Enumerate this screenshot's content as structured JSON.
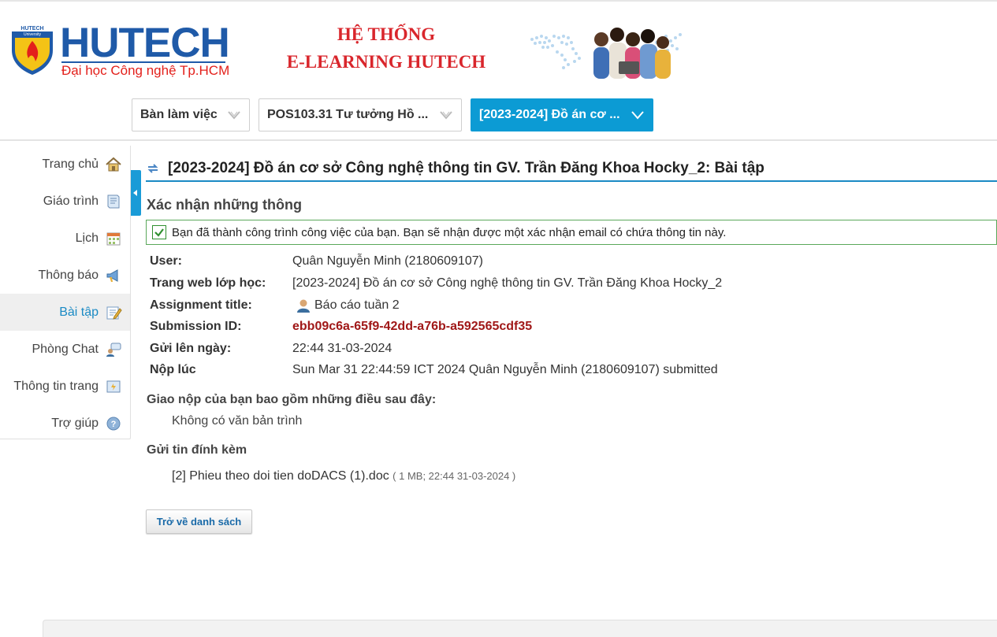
{
  "brand": {
    "logo_word": "HUTECH",
    "logo_small": "HUTECH University",
    "logo_sub": "Đại học Công nghệ Tp.HCM",
    "system_title_1": "HỆ THỐNG",
    "system_title_2": "E-LEARNING HUTECH"
  },
  "nav": {
    "dropdowns": [
      {
        "label": "Bàn làm việc"
      },
      {
        "label": "POS103.31 Tư tưởng Hồ ..."
      },
      {
        "label": "[2023-2024] Đồ án cơ ..."
      }
    ]
  },
  "sidebar": {
    "items": [
      {
        "label": "Trang chủ",
        "icon": "home-icon"
      },
      {
        "label": "Giáo trình",
        "icon": "book-icon"
      },
      {
        "label": "Lịch",
        "icon": "calendar-icon"
      },
      {
        "label": "Thông báo",
        "icon": "megaphone-icon"
      },
      {
        "label": "Bài tập",
        "icon": "assignment-icon"
      },
      {
        "label": "Phòng Chat",
        "icon": "chat-icon"
      },
      {
        "label": "Thông tin trang",
        "icon": "site-info-icon"
      },
      {
        "label": "Trợ giúp",
        "icon": "help-icon"
      }
    ],
    "active_index": 4
  },
  "main": {
    "title": "[2023-2024] Đồ án cơ sở Công nghệ thông tin GV. Trần Đăng Khoa Hocky_2: Bài tập",
    "confirm_heading": "Xác nhận những thông",
    "success_message": "Bạn đã thành công trình công việc của bạn. Bạn sẽ nhận được một xác nhận email có chứa thông tin này.",
    "details": [
      {
        "key": "User:",
        "value": "Quân Nguyễn Minh (2180609107)"
      },
      {
        "key": "Trang web lớp học:",
        "value": "[2023-2024] Đồ án cơ sở Công nghệ thông tin GV. Trần Đăng Khoa Hocky_2"
      },
      {
        "key": "Assignment title:",
        "value": "Báo cáo tuần 2"
      },
      {
        "key": "Submission ID:",
        "value": "ebb09c6a-65f9-42dd-a76b-a592565cdf35"
      },
      {
        "key": "Gửi lên ngày:",
        "value": "22:44 31-03-2024"
      },
      {
        "key": "Nộp lúc",
        "value": "Sun Mar 31 22:44:59 ICT 2024 Quân Nguyễn Minh (2180609107) submitted"
      }
    ],
    "submission_heading": "Giao nộp của bạn bao gồm những điều sau đây:",
    "no_text": "Không có văn bản trình",
    "attachments_heading": "Gửi tin đính kèm",
    "attachment": {
      "name": "[2] Phieu theo doi tien doDACS (1).doc",
      "meta": "( 1 MB; 22:44 31-03-2024 )"
    },
    "back_button": "Trở về danh sách"
  },
  "colors": {
    "accent": "#0c9bd4",
    "brand_blue": "#1f5aa8",
    "brand_red": "#d9262c",
    "submission_id": "#a01818",
    "success_border": "#5aa85a"
  }
}
